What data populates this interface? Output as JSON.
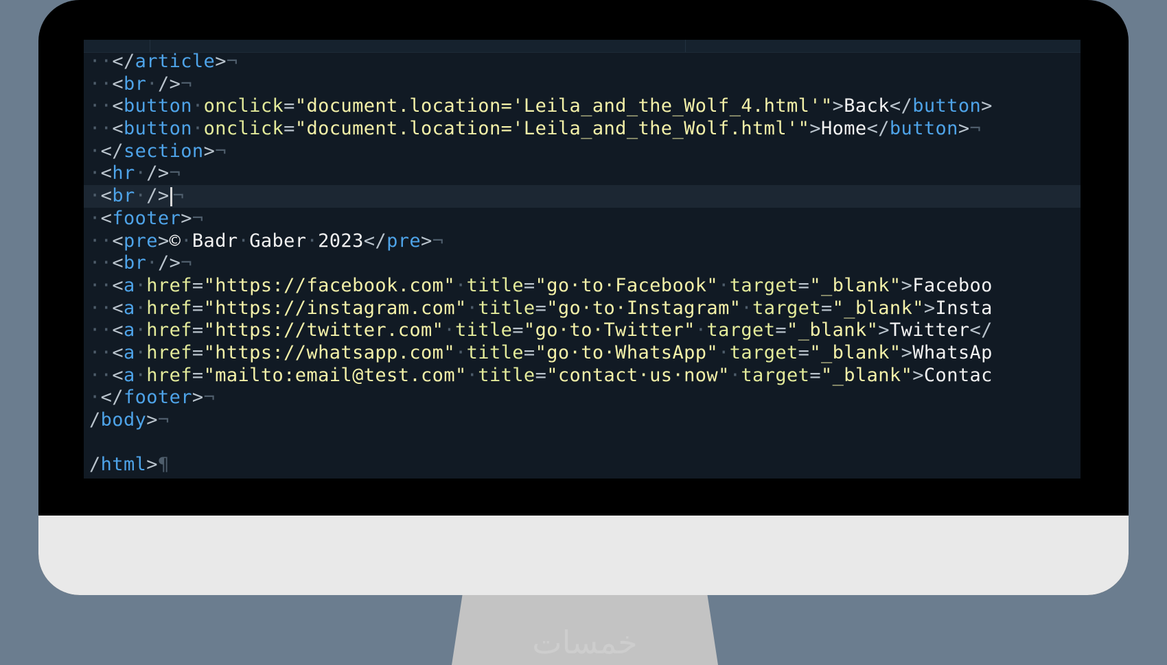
{
  "colors": {
    "background": "#6b7d8f",
    "bezel": "#000000",
    "chin": "#e9e9e9",
    "screen": "#111a24",
    "tag": "#4ea3e8",
    "attribute": "#e3ea9a",
    "string": "#f3f0a8",
    "text": "#f1f1f1",
    "whitespace_marker": "#4e5d6b"
  },
  "editor": {
    "current_line_index": 6,
    "lines": [
      {
        "indent": "··",
        "tokens": [
          {
            "t": "br",
            "v": "</"
          },
          {
            "t": "tag",
            "v": "article"
          },
          {
            "t": "br",
            "v": ">"
          }
        ],
        "eol": "¬"
      },
      {
        "indent": "··",
        "tokens": [
          {
            "t": "br",
            "v": "<"
          },
          {
            "t": "tag",
            "v": "br"
          },
          {
            "t": "ws",
            "v": "·"
          },
          {
            "t": "br",
            "v": "/>"
          }
        ],
        "eol": "¬"
      },
      {
        "indent": "··",
        "tokens": [
          {
            "t": "br",
            "v": "<"
          },
          {
            "t": "tag",
            "v": "button"
          },
          {
            "t": "ws",
            "v": "·"
          },
          {
            "t": "attr",
            "v": "onclick"
          },
          {
            "t": "br",
            "v": "="
          },
          {
            "t": "str",
            "v": "\"document.location='Leila_and_the_Wolf_4.html'\""
          },
          {
            "t": "br",
            "v": ">"
          },
          {
            "t": "txt",
            "v": "Back"
          },
          {
            "t": "br",
            "v": "</"
          },
          {
            "t": "tag",
            "v": "button"
          },
          {
            "t": "br",
            "v": ">"
          }
        ],
        "eol": ""
      },
      {
        "indent": "··",
        "tokens": [
          {
            "t": "br",
            "v": "<"
          },
          {
            "t": "tag",
            "v": "button"
          },
          {
            "t": "ws",
            "v": "·"
          },
          {
            "t": "attr",
            "v": "onclick"
          },
          {
            "t": "br",
            "v": "="
          },
          {
            "t": "str",
            "v": "\"document.location='Leila_and_the_Wolf.html'\""
          },
          {
            "t": "br",
            "v": ">"
          },
          {
            "t": "txt",
            "v": "Home"
          },
          {
            "t": "br",
            "v": "</"
          },
          {
            "t": "tag",
            "v": "button"
          },
          {
            "t": "br",
            "v": ">"
          }
        ],
        "eol": "¬"
      },
      {
        "indent": "·",
        "tokens": [
          {
            "t": "br",
            "v": "</"
          },
          {
            "t": "tag",
            "v": "section"
          },
          {
            "t": "br",
            "v": ">"
          }
        ],
        "eol": "¬"
      },
      {
        "indent": "·",
        "tokens": [
          {
            "t": "br",
            "v": "<"
          },
          {
            "t": "tag",
            "v": "hr"
          },
          {
            "t": "ws",
            "v": "·"
          },
          {
            "t": "br",
            "v": "/>"
          }
        ],
        "eol": "¬"
      },
      {
        "indent": "·",
        "tokens": [
          {
            "t": "br",
            "v": "<"
          },
          {
            "t": "tag",
            "v": "br"
          },
          {
            "t": "ws",
            "v": "·"
          },
          {
            "t": "br",
            "v": "/>"
          },
          {
            "t": "caret",
            "v": ""
          }
        ],
        "eol": "¬"
      },
      {
        "indent": "·",
        "tokens": [
          {
            "t": "br",
            "v": "<"
          },
          {
            "t": "tag",
            "v": "footer"
          },
          {
            "t": "br",
            "v": ">"
          }
        ],
        "eol": "¬"
      },
      {
        "indent": "··",
        "tokens": [
          {
            "t": "br",
            "v": "<"
          },
          {
            "t": "tag",
            "v": "pre"
          },
          {
            "t": "br",
            "v": ">"
          },
          {
            "t": "txt",
            "v": "©"
          },
          {
            "t": "ws",
            "v": "·"
          },
          {
            "t": "txt",
            "v": "Badr"
          },
          {
            "t": "ws",
            "v": "·"
          },
          {
            "t": "txt",
            "v": "Gaber"
          },
          {
            "t": "ws",
            "v": "·"
          },
          {
            "t": "txt",
            "v": "2023"
          },
          {
            "t": "br",
            "v": "</"
          },
          {
            "t": "tag",
            "v": "pre"
          },
          {
            "t": "br",
            "v": ">"
          }
        ],
        "eol": "¬"
      },
      {
        "indent": "··",
        "tokens": [
          {
            "t": "br",
            "v": "<"
          },
          {
            "t": "tag",
            "v": "br"
          },
          {
            "t": "ws",
            "v": "·"
          },
          {
            "t": "br",
            "v": "/>"
          }
        ],
        "eol": "¬"
      },
      {
        "indent": "··",
        "tokens": [
          {
            "t": "br",
            "v": "<"
          },
          {
            "t": "tag",
            "v": "a"
          },
          {
            "t": "ws",
            "v": "·"
          },
          {
            "t": "attr",
            "v": "href"
          },
          {
            "t": "br",
            "v": "="
          },
          {
            "t": "str",
            "v": "\"https://facebook.com\""
          },
          {
            "t": "ws",
            "v": "·"
          },
          {
            "t": "attr",
            "v": "title"
          },
          {
            "t": "br",
            "v": "="
          },
          {
            "t": "str",
            "v": "\"go·to·Facebook\""
          },
          {
            "t": "ws",
            "v": "·"
          },
          {
            "t": "attr",
            "v": "target"
          },
          {
            "t": "br",
            "v": "="
          },
          {
            "t": "str",
            "v": "\"_blank\""
          },
          {
            "t": "br",
            "v": ">"
          },
          {
            "t": "txt",
            "v": "Faceboo"
          }
        ],
        "eol": ""
      },
      {
        "indent": "··",
        "tokens": [
          {
            "t": "br",
            "v": "<"
          },
          {
            "t": "tag",
            "v": "a"
          },
          {
            "t": "ws",
            "v": "·"
          },
          {
            "t": "attr",
            "v": "href"
          },
          {
            "t": "br",
            "v": "="
          },
          {
            "t": "str",
            "v": "\"https://instagram.com\""
          },
          {
            "t": "ws",
            "v": "·"
          },
          {
            "t": "attr",
            "v": "title"
          },
          {
            "t": "br",
            "v": "="
          },
          {
            "t": "str",
            "v": "\"go·to·Instagram\""
          },
          {
            "t": "ws",
            "v": "·"
          },
          {
            "t": "attr",
            "v": "target"
          },
          {
            "t": "br",
            "v": "="
          },
          {
            "t": "str",
            "v": "\"_blank\""
          },
          {
            "t": "br",
            "v": ">"
          },
          {
            "t": "txt",
            "v": "Insta"
          }
        ],
        "eol": ""
      },
      {
        "indent": "··",
        "tokens": [
          {
            "t": "br",
            "v": "<"
          },
          {
            "t": "tag",
            "v": "a"
          },
          {
            "t": "ws",
            "v": "·"
          },
          {
            "t": "attr",
            "v": "href"
          },
          {
            "t": "br",
            "v": "="
          },
          {
            "t": "str",
            "v": "\"https://twitter.com\""
          },
          {
            "t": "ws",
            "v": "·"
          },
          {
            "t": "attr",
            "v": "title"
          },
          {
            "t": "br",
            "v": "="
          },
          {
            "t": "str",
            "v": "\"go·to·Twitter\""
          },
          {
            "t": "ws",
            "v": "·"
          },
          {
            "t": "attr",
            "v": "target"
          },
          {
            "t": "br",
            "v": "="
          },
          {
            "t": "str",
            "v": "\"_blank\""
          },
          {
            "t": "br",
            "v": ">"
          },
          {
            "t": "txt",
            "v": "Twitter"
          },
          {
            "t": "br",
            "v": "</"
          }
        ],
        "eol": ""
      },
      {
        "indent": "··",
        "tokens": [
          {
            "t": "br",
            "v": "<"
          },
          {
            "t": "tag",
            "v": "a"
          },
          {
            "t": "ws",
            "v": "·"
          },
          {
            "t": "attr",
            "v": "href"
          },
          {
            "t": "br",
            "v": "="
          },
          {
            "t": "str",
            "v": "\"https://whatsapp.com\""
          },
          {
            "t": "ws",
            "v": "·"
          },
          {
            "t": "attr",
            "v": "title"
          },
          {
            "t": "br",
            "v": "="
          },
          {
            "t": "str",
            "v": "\"go·to·WhatsApp\""
          },
          {
            "t": "ws",
            "v": "·"
          },
          {
            "t": "attr",
            "v": "target"
          },
          {
            "t": "br",
            "v": "="
          },
          {
            "t": "str",
            "v": "\"_blank\""
          },
          {
            "t": "br",
            "v": ">"
          },
          {
            "t": "txt",
            "v": "WhatsAp"
          }
        ],
        "eol": ""
      },
      {
        "indent": "··",
        "tokens": [
          {
            "t": "br",
            "v": "<"
          },
          {
            "t": "tag",
            "v": "a"
          },
          {
            "t": "ws",
            "v": "·"
          },
          {
            "t": "attr",
            "v": "href"
          },
          {
            "t": "br",
            "v": "="
          },
          {
            "t": "str",
            "v": "\"mailto:email@test.com\""
          },
          {
            "t": "ws",
            "v": "·"
          },
          {
            "t": "attr",
            "v": "title"
          },
          {
            "t": "br",
            "v": "="
          },
          {
            "t": "str",
            "v": "\"contact·us·now\""
          },
          {
            "t": "ws",
            "v": "·"
          },
          {
            "t": "attr",
            "v": "target"
          },
          {
            "t": "br",
            "v": "="
          },
          {
            "t": "str",
            "v": "\"_blank\""
          },
          {
            "t": "br",
            "v": ">"
          },
          {
            "t": "txt",
            "v": "Contac"
          }
        ],
        "eol": ""
      },
      {
        "indent": "·",
        "tokens": [
          {
            "t": "br",
            "v": "</"
          },
          {
            "t": "tag",
            "v": "footer"
          },
          {
            "t": "br",
            "v": ">"
          }
        ],
        "eol": "¬"
      },
      {
        "indent": "",
        "tokens": [
          {
            "t": "br",
            "v": "/"
          },
          {
            "t": "tag",
            "v": "body"
          },
          {
            "t": "br",
            "v": ">"
          }
        ],
        "eol": "¬"
      },
      {
        "indent": "",
        "tokens": [],
        "eol": ""
      },
      {
        "indent": "",
        "tokens": [
          {
            "t": "br",
            "v": "/"
          },
          {
            "t": "tag",
            "v": "html"
          },
          {
            "t": "br",
            "v": ">"
          }
        ],
        "eol": "¶"
      }
    ]
  },
  "watermark": "خمسات"
}
